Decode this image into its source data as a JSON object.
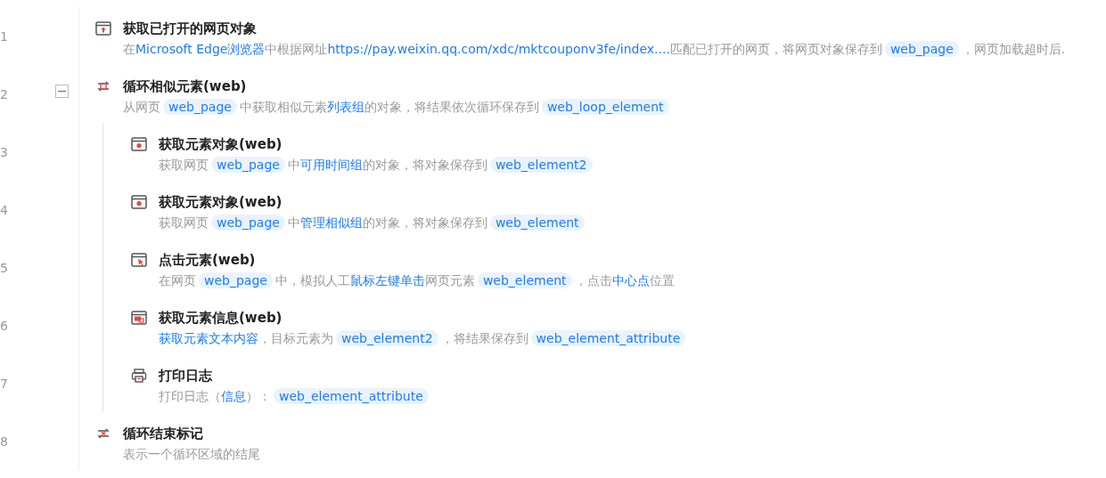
{
  "steps": [
    {
      "line": "1",
      "kind": "open-page",
      "title": "获取已打开的网页对象",
      "description": [
        {
          "kind": "text",
          "text": "在"
        },
        {
          "kind": "value",
          "text": "Microsoft Edge浏览器"
        },
        {
          "kind": "text",
          "text": "中根据网址"
        },
        {
          "kind": "value",
          "text": "https://pay.weixin.qq.com/xdc/mktcouponv3fe/index...."
        },
        {
          "kind": "text",
          "text": "匹配已打开的网页，将网页对象保存到"
        },
        {
          "kind": "var",
          "text": "web_page"
        },
        {
          "kind": "text",
          "text": "，网页加载超时后."
        }
      ]
    },
    {
      "line": "2",
      "kind": "loop",
      "title": "循环相似元素(web)",
      "expanded": true,
      "description": [
        {
          "kind": "text",
          "text": "从网页"
        },
        {
          "kind": "var",
          "text": "web_page"
        },
        {
          "kind": "text",
          "text": "中获取相似元素"
        },
        {
          "kind": "value",
          "text": "列表组"
        },
        {
          "kind": "text",
          "text": "的对象，将结果依次循环保存到"
        },
        {
          "kind": "var",
          "text": "web_loop_element"
        }
      ],
      "children": [
        {
          "line": "3",
          "kind": "get-element",
          "title": "获取元素对象(web)",
          "description": [
            {
              "kind": "text",
              "text": "获取网页"
            },
            {
              "kind": "var",
              "text": "web_page"
            },
            {
              "kind": "text",
              "text": "中"
            },
            {
              "kind": "value",
              "text": "可用时间组"
            },
            {
              "kind": "text",
              "text": "的对象，将对象保存到"
            },
            {
              "kind": "var",
              "text": "web_element2"
            }
          ]
        },
        {
          "line": "4",
          "kind": "get-element",
          "title": "获取元素对象(web)",
          "description": [
            {
              "kind": "text",
              "text": "获取网页"
            },
            {
              "kind": "var",
              "text": "web_page"
            },
            {
              "kind": "text",
              "text": "中"
            },
            {
              "kind": "value",
              "text": "管理相似组"
            },
            {
              "kind": "text",
              "text": "的对象，将对象保存到"
            },
            {
              "kind": "var",
              "text": "web_element"
            }
          ]
        },
        {
          "line": "5",
          "kind": "click",
          "title": "点击元素(web)",
          "description": [
            {
              "kind": "text",
              "text": "在网页"
            },
            {
              "kind": "var",
              "text": "web_page"
            },
            {
              "kind": "text",
              "text": "中，模拟人工"
            },
            {
              "kind": "value",
              "text": "鼠标左键单击"
            },
            {
              "kind": "text",
              "text": "网页元素"
            },
            {
              "kind": "var",
              "text": "web_element"
            },
            {
              "kind": "text",
              "text": "，点击"
            },
            {
              "kind": "value",
              "text": "中心点"
            },
            {
              "kind": "text",
              "text": "位置"
            }
          ]
        },
        {
          "line": "6",
          "kind": "get-info",
          "title": "获取元素信息(web)",
          "description": [
            {
              "kind": "value",
              "text": "获取元素文本内容"
            },
            {
              "kind": "text",
              "text": "，目标元素为"
            },
            {
              "kind": "var",
              "text": "web_element2"
            },
            {
              "kind": "text",
              "text": "，将结果保存到"
            },
            {
              "kind": "var",
              "text": "web_element_attribute"
            }
          ]
        },
        {
          "line": "7",
          "kind": "print",
          "title": "打印日志",
          "description": [
            {
              "kind": "text",
              "text": "打印日志（"
            },
            {
              "kind": "value",
              "text": "信息"
            },
            {
              "kind": "text",
              "text": "）："
            },
            {
              "kind": "var",
              "text": "web_element_attribute"
            }
          ]
        }
      ]
    },
    {
      "line": "8",
      "kind": "loop-end",
      "title": "循环结束标记",
      "description": [
        {
          "kind": "text",
          "text": "表示一个循环区域的结尾"
        }
      ]
    }
  ]
}
